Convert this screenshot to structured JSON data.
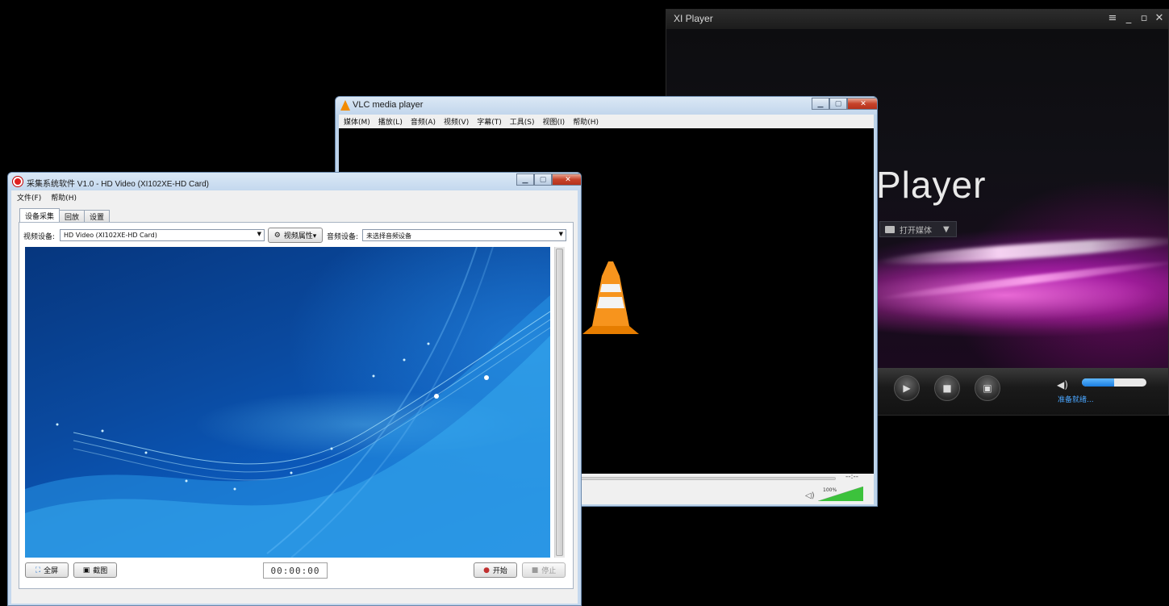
{
  "xi_player": {
    "title": "XI Player",
    "controls": {
      "menu": "≡",
      "minimize": "_",
      "restore": "▫",
      "close": "✕"
    },
    "logo_text": "Player",
    "open_media_label": "打开媒体",
    "open_media_dropdown": "▼",
    "buttons": {
      "play": "▶",
      "stop": "■",
      "fullscreen": "▣"
    },
    "volume_level": 0.5,
    "status_text": "准备就绪...",
    "accent_color": "#3a9bff"
  },
  "vlc": {
    "title": "VLC media player",
    "menu": [
      "媒体(M)",
      "播放(L)",
      "音频(A)",
      "视频(V)",
      "字幕(T)",
      "工具(S)",
      "视图(I)",
      "帮助(H)"
    ],
    "time": "--:--",
    "volume_percent": "100%",
    "volume_level": 1.0
  },
  "capture": {
    "title": "采集系统软件 V1.0 - HD Video (XI102XE-HD Card)",
    "menu": [
      "文件(F)",
      "帮助(H)"
    ],
    "tabs": [
      "设备采集",
      "回放",
      "设置"
    ],
    "active_tab": 0,
    "video_device_label": "视频设备:",
    "video_device_value": "HD Video (XI102XE-HD Card)",
    "video_props_button": "视频属性▾",
    "audio_device_label": "音频设备:",
    "audio_device_value": "未选择音频设备",
    "fullscreen_button": "全屏",
    "screenshot_button": "截图",
    "timer": "00:00:00",
    "start_button": "开始",
    "stop_button": "停止"
  }
}
